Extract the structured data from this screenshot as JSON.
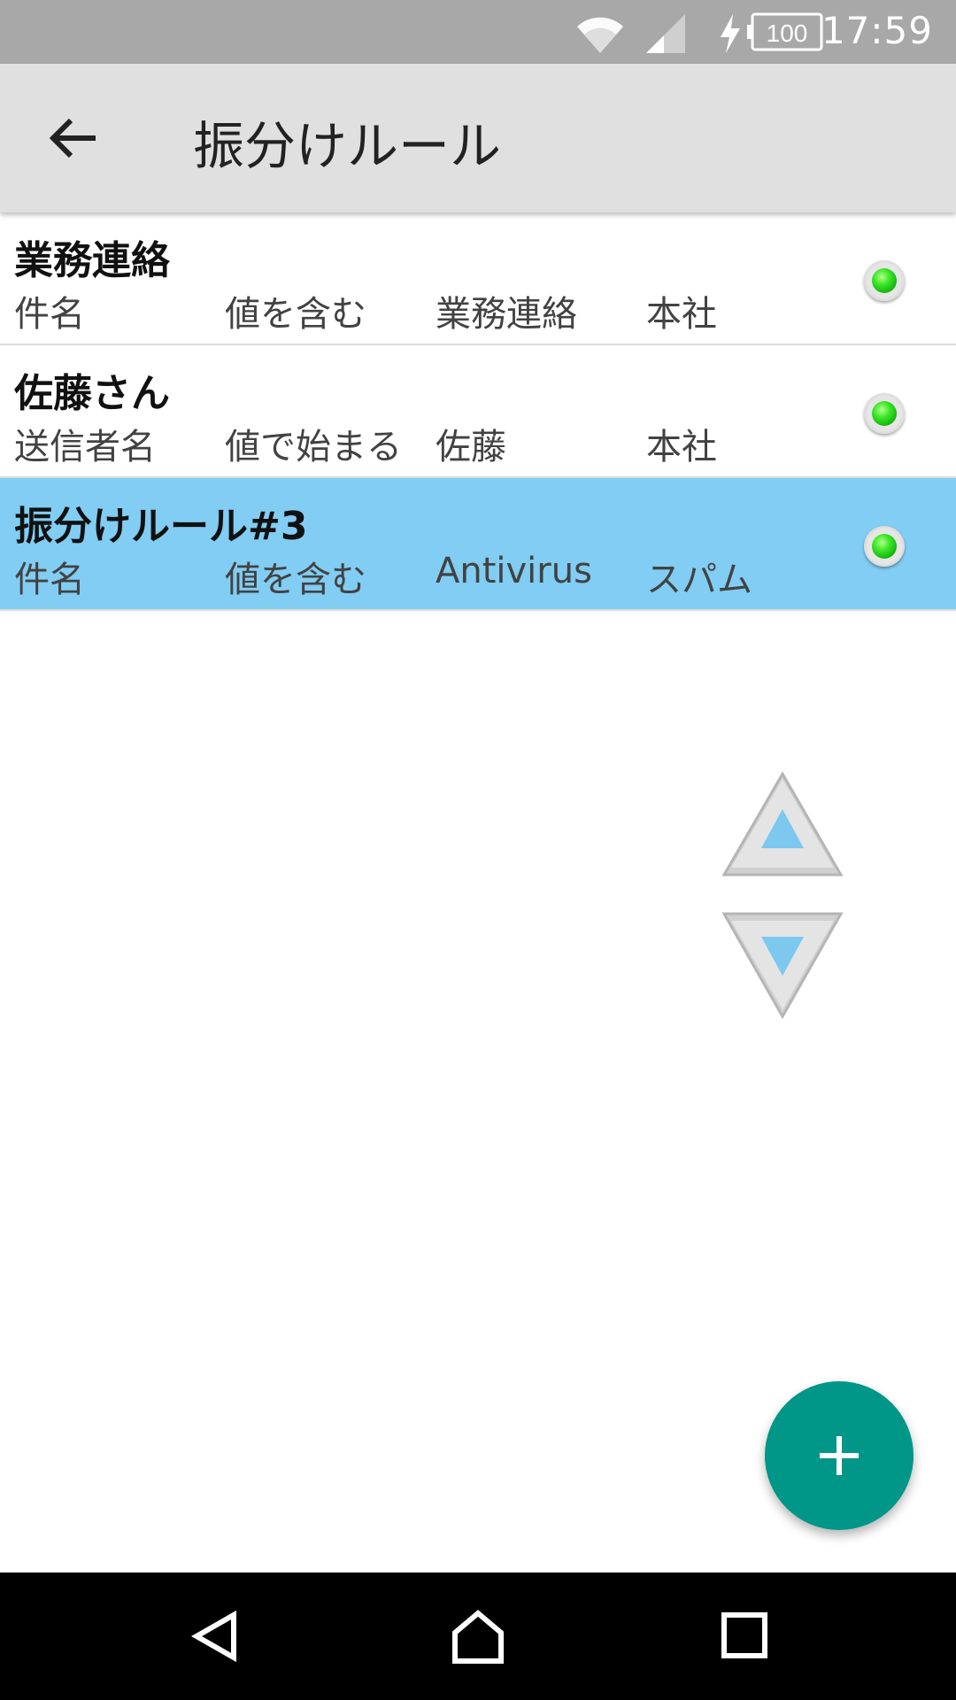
{
  "status_bar": {
    "time": "17:59",
    "battery_level": "100"
  },
  "toolbar": {
    "title": "振分けルール",
    "back_icon": "arrow-left-icon"
  },
  "rules": [
    {
      "name": "業務連絡",
      "field": "件名",
      "condition": "値を含む",
      "value": "業務連絡",
      "folder": "本社",
      "enabled": true,
      "selected": false
    },
    {
      "name": "佐藤さん",
      "field": "送信者名",
      "condition": "値で始まる",
      "value": "佐藤",
      "folder": "本社",
      "enabled": true,
      "selected": false
    },
    {
      "name": "振分けルール#3",
      "field": "件名",
      "condition": "値を含む",
      "value": "Antivirus",
      "folder": "スパム",
      "enabled": true,
      "selected": true
    }
  ],
  "colors": {
    "selected_row": "#81cdf3",
    "fab": "#009688",
    "status_bar": "#a8a8a8",
    "toolbar": "#e0e0e0",
    "led_on": "#3ee82a"
  },
  "icons": {
    "move_up": "triangle-up-icon",
    "move_down": "triangle-down-icon",
    "fab": "plus-icon",
    "nav_back": "nav-back-icon",
    "nav_home": "nav-home-icon",
    "nav_recents": "nav-recents-icon"
  }
}
